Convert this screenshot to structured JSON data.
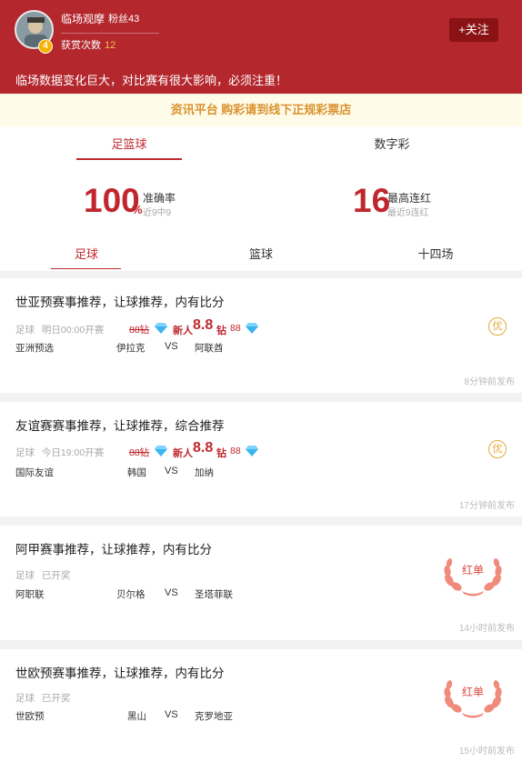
{
  "header": {
    "user_name": "临场观摩",
    "fans": "粉丝43",
    "level": "4",
    "reward_label": "获赏次数",
    "reward_count": "12",
    "follow_label": "+关注",
    "notice": "临场数据变化巨大，对比赛有很大影响，必须注重！"
  },
  "banner": "资讯平台 购彩请到线下正规彩票店",
  "top_tabs": [
    "足篮球",
    "数字彩"
  ],
  "stats": {
    "accuracy_value": "100",
    "accuracy_unit": "%",
    "accuracy_label": "准确率",
    "accuracy_sub": "近9中9",
    "streak_value": "16",
    "streak_label": "最高连红",
    "streak_sub": "最近9连红"
  },
  "sub_tabs": [
    "足球",
    "篮球",
    "十四场"
  ],
  "colors": {
    "brand_red": "#b3272d",
    "accent_red": "#c0272d",
    "gold": "#e7a93a",
    "banner_text": "#d9922c"
  },
  "cards": [
    {
      "title": "世亚预赛事推荐，让球推荐，内有比分",
      "sport": "足球",
      "status": "明日00:00开赛",
      "old_price": "88钻",
      "newbie_label": "新人",
      "newbie_price": "8.8",
      "zuan": "钻",
      "orig": "88",
      "league": "亚洲预选",
      "home": "伊拉克",
      "vs": "VS",
      "away": "阿联酋",
      "badge": "优",
      "time_ago": "8分钟前发布"
    },
    {
      "title": "友谊赛赛事推荐，让球推荐，综合推荐",
      "sport": "足球",
      "status": "今日19:00开赛",
      "old_price": "88钻",
      "newbie_label": "新人",
      "newbie_price": "8.8",
      "zuan": "钻",
      "orig": "88",
      "league": "国际友谊",
      "home": "韩国",
      "vs": "VS",
      "away": "加纳",
      "badge": "优",
      "time_ago": "17分钟前发布"
    },
    {
      "title": "阿甲赛事推荐，让球推荐，内有比分",
      "sport": "足球",
      "status": "已开奖",
      "league": "阿职联",
      "home": "贝尔格",
      "vs": "VS",
      "away": "圣塔菲联",
      "badge": "红单",
      "time_ago": "14小时前发布"
    },
    {
      "title": "世欧预赛事推荐，让球推荐，内有比分",
      "sport": "足球",
      "status": "已开奖",
      "league": "世欧预",
      "home": "黑山",
      "vs": "VS",
      "away": "克罗地亚",
      "badge": "红单",
      "time_ago": "15小时前发布"
    }
  ]
}
